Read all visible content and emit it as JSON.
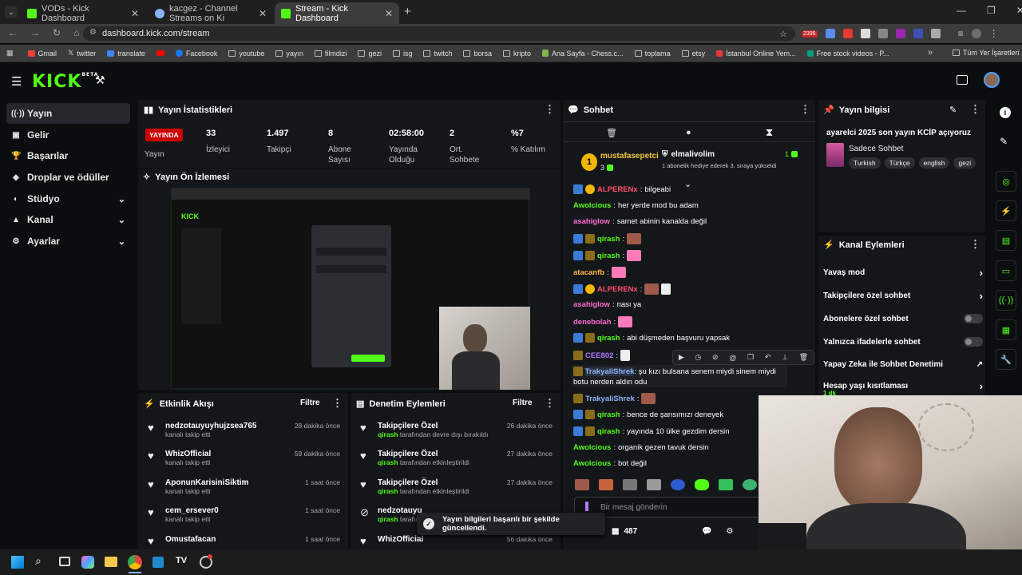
{
  "browser": {
    "tabs": [
      {
        "title": "VODs - Kick Dashboard",
        "favicon": "kick-icon",
        "color": "#53fc18"
      },
      {
        "title": "kacgez - Channel Streams on Ki",
        "favicon": "globe-icon",
        "color": "#8ab4f8"
      },
      {
        "title": "Stream - Kick Dashboard",
        "favicon": "kick-icon",
        "color": "#53fc18"
      }
    ],
    "new_tab": "+",
    "url": "dashboard.kick.com/stream",
    "bookmarks": [
      "Gmail",
      "twitter",
      "translate",
      "Facebook",
      "youtube",
      "yayın",
      "filmdizi",
      "gezi",
      "isg",
      "twitch",
      "borsa",
      "kripto",
      "Ana Sayfa - Chess.c...",
      "toplama",
      "etsy",
      "İstanbul Online Yem...",
      "Free stock videos - P..."
    ],
    "bookmarks_more": "»",
    "all_bookmarks": "Tüm Yer İşaretleri",
    "ext_badge": "2395"
  },
  "kick": {
    "logo": "KICK",
    "beta": "BETA"
  },
  "sidebar": [
    {
      "label": "Yayın",
      "icon": "broadcast-icon",
      "selected": true
    },
    {
      "label": "Gelir",
      "icon": "money-icon"
    },
    {
      "label": "Başarılar",
      "icon": "trophy-icon"
    },
    {
      "label": "Droplar ve ödüller",
      "icon": "gift-icon"
    },
    {
      "label": "Stüdyo",
      "icon": "studio-icon",
      "expandable": true
    },
    {
      "label": "Kanal",
      "icon": "channel-icon",
      "expandable": true
    },
    {
      "label": "Ayarlar",
      "icon": "gear-icon",
      "expandable": true
    }
  ],
  "stats": {
    "title": "Yayın İstatistikleri",
    "live_badge": "YAYINDA",
    "live_label": "Yayın",
    "items": [
      {
        "value": "33",
        "label": "İzleyici"
      },
      {
        "value": "1.497",
        "label": "Takipçi"
      },
      {
        "value": "8",
        "label": "Abone Sayısı"
      },
      {
        "value": "02:58:00",
        "label": "Yayında Olduğu"
      },
      {
        "value": "2",
        "label": "Ort. Sohbete"
      },
      {
        "value": "%7",
        "label": "% Katılım"
      }
    ]
  },
  "preview": {
    "title": "Yayın Ön İzlemesi"
  },
  "activity": {
    "title": "Etkinlik Akışı",
    "filter": "Filtre",
    "items": [
      {
        "name": "nedzotauyuyhujzsea765",
        "sub": "kanalı takip etti",
        "time": "28 dakika önce"
      },
      {
        "name": "WhizOfficial",
        "sub": "kanalı takip etti",
        "time": "59 dakika önce"
      },
      {
        "name": "AponunKarisiniSiktim",
        "sub": "kanalı takip etti",
        "time": "1 saat önce"
      },
      {
        "name": "cem_ersever0",
        "sub": "kanalı takip etti",
        "time": "1 saat önce"
      },
      {
        "name": "Omustafacan",
        "sub": "",
        "time": "1 saat önce"
      }
    ]
  },
  "moderation": {
    "title": "Denetim Eylemleri",
    "filter": "Filtre",
    "items": [
      {
        "name": "Takipçilere Özel",
        "user": "qirash",
        "sub": "tarafından devre dışı bırakıldı",
        "time": "26 dakika önce"
      },
      {
        "name": "Takipçilere Özel",
        "user": "qirash",
        "sub": "tarafından etkinleştirildi",
        "time": "27 dakika önce"
      },
      {
        "name": "Takipçilere Özel",
        "user": "qirash",
        "sub": "tarafından etkinleştirildi",
        "time": "27 dakika önce"
      },
      {
        "name": "nedzotauyu",
        "user": "qirash",
        "sub": "tarafından",
        "time": ""
      },
      {
        "name": "WhizOfficial",
        "user": "",
        "sub": "",
        "time": "56 dakika önce"
      }
    ]
  },
  "chat": {
    "title": "Sohbet",
    "pinned": {
      "user": "mustafasepetci",
      "level": "3",
      "gifter": "elmalivolim",
      "gift_text": "1 abonelik hediye ederek 3. sıraya yükseldi",
      "count": "1"
    },
    "messages": [
      {
        "user": "ALPERENx",
        "text": "bilgeabi",
        "color": "#ff4d6a"
      },
      {
        "user": "Awolcious",
        "text": "her yerde mod bu adam",
        "color": "#53fc18"
      },
      {
        "user": "asahiglow",
        "text": "samet abinin kanalda değil",
        "color": "#ff6bd5"
      },
      {
        "user": "qirash",
        "text": "",
        "color": "#53fc18"
      },
      {
        "user": "qirash",
        "text": "",
        "color": "#53fc18"
      },
      {
        "user": "atacanfb",
        "text": "",
        "color": "#ffb347"
      },
      {
        "user": "ALPERENx",
        "text": "",
        "color": "#ff4d6a"
      },
      {
        "user": "asahiglow",
        "text": "nası ya",
        "color": "#ff6bd5"
      },
      {
        "user": "denebolah",
        "text": "",
        "color": "#ff6bd5"
      },
      {
        "user": "qirash",
        "text": "abi düşmeden başvuru yapsak",
        "color": "#53fc18"
      },
      {
        "user": "CEE802",
        "text": "",
        "color": "#b07bff"
      },
      {
        "user": "TrakyaliShrek",
        "text": "şu kızı bulsana senem miydi sinem miydi botu nerden aldın odu",
        "color": "#8ab4f8"
      },
      {
        "user": "TrakyaliShrek",
        "text": "",
        "color": "#8ab4f8"
      },
      {
        "user": "qirash",
        "text": "bence de şansımızı deneyek",
        "color": "#53fc18"
      },
      {
        "user": "qirash",
        "text": "yayında 10 ülke gezdim dersin",
        "color": "#53fc18"
      },
      {
        "user": "Awolcious",
        "text": "organik gezen tavuk dersin",
        "color": "#53fc18"
      },
      {
        "user": "Awolcious",
        "text": "bot değil",
        "color": "#53fc18"
      }
    ],
    "input_placeholder": "Bir mesaj gönderin",
    "viewer_count": "487"
  },
  "toast": {
    "text": "Yayın bilgileri başarılı bir şekilde güncellendi."
  },
  "stream_info": {
    "title": "Yayın bilgisi",
    "stream_title": "ayarelci 2025 son yayın KCİP açıyoruz",
    "category": "Sadece Sohbet",
    "tags": [
      "Turkish",
      "Türkçe",
      "english",
      "gezi"
    ]
  },
  "channel_actions": {
    "title": "Kanal Eylemleri",
    "items": [
      {
        "label": "Yavaş mod",
        "type": "arrow"
      },
      {
        "label": "Takipçilere özel sohbet",
        "type": "arrow"
      },
      {
        "label": "Abonelere özel sohbet",
        "type": "toggle"
      },
      {
        "label": "Yalnızca ifadelerle sohbet",
        "type": "toggle"
      },
      {
        "label": "Yapay Zeka ile Sohbet Denetimi",
        "type": "link"
      },
      {
        "label": "Hesap yaşı kısıtlaması",
        "type": "arrow",
        "sub": "1 dk"
      }
    ]
  }
}
